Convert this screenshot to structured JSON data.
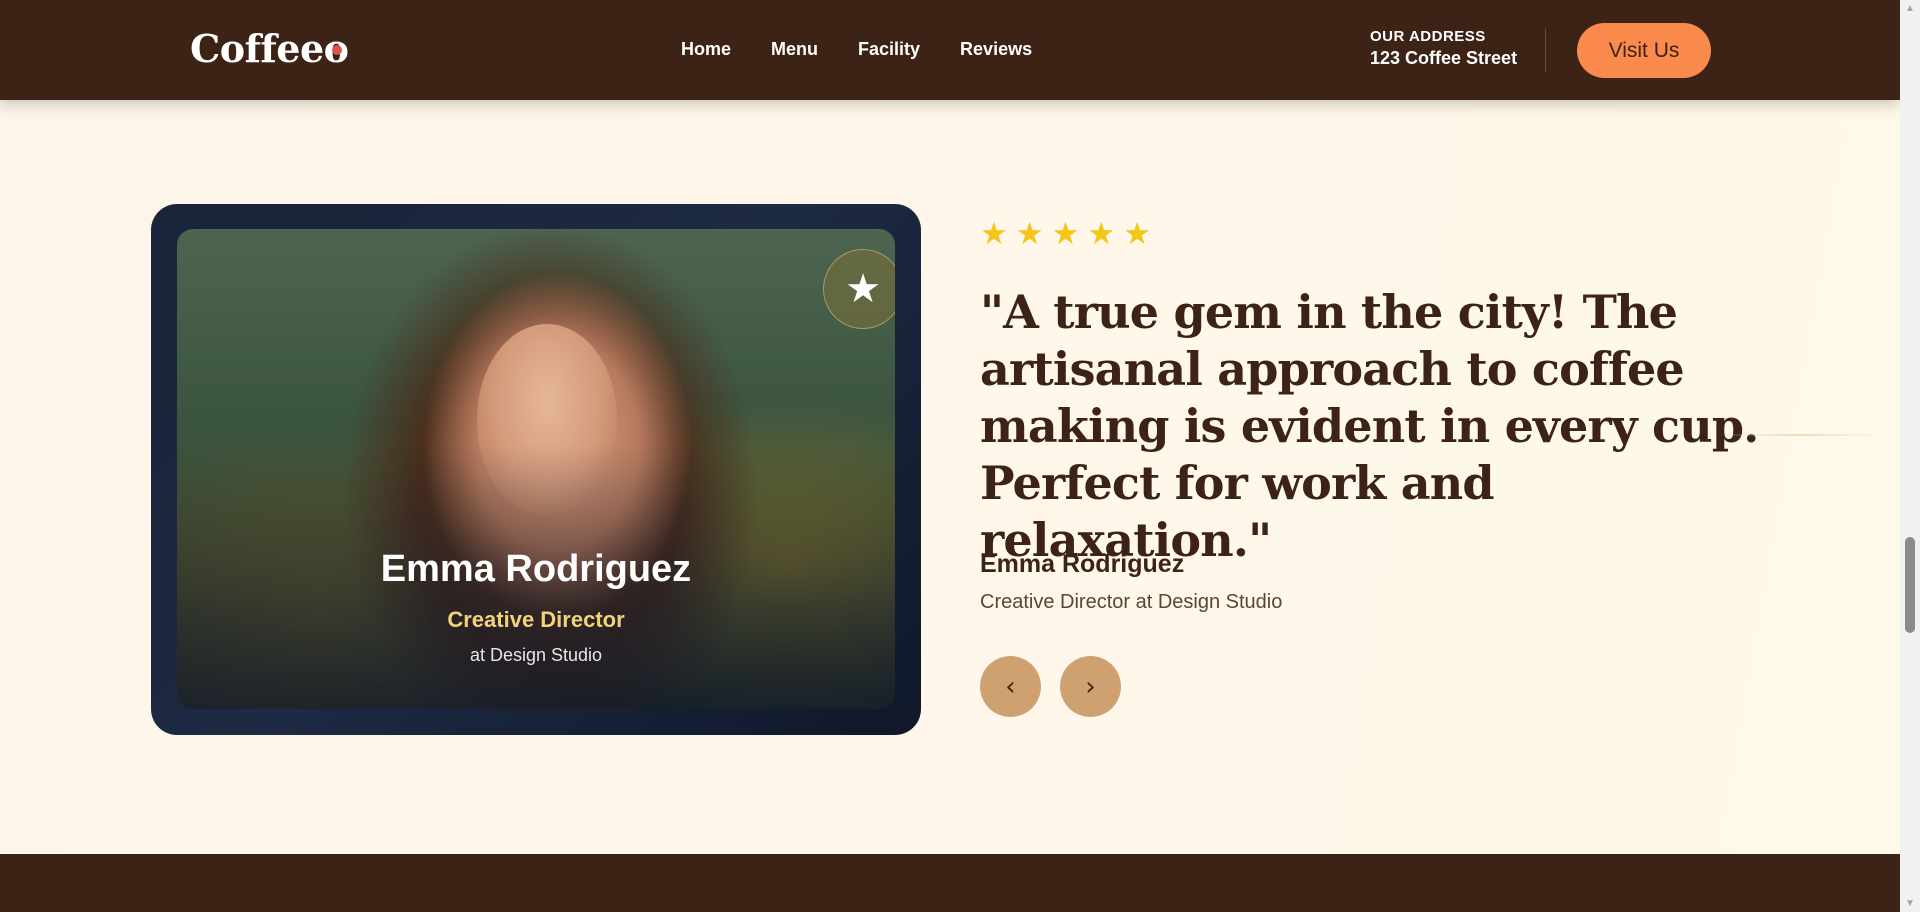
{
  "header": {
    "logo": "Coffeeo",
    "nav": [
      "Home",
      "Menu",
      "Facility",
      "Reviews"
    ],
    "address_label": "OUR ADDRESS",
    "address_value": "123 Coffee Street",
    "cta": "Visit Us"
  },
  "testimonial": {
    "rating": 5,
    "stars": [
      "★",
      "★",
      "★",
      "★",
      "★"
    ],
    "quote": "\"A true gem in the city! The artisanal approach to coffee making is evident in every cup. Perfect for work and relaxation.\"",
    "author": "Emma Rodriguez",
    "author_role": "Creative Director at Design Studio",
    "prev_icon": "‹",
    "next_icon": "›"
  },
  "card": {
    "badge_icon": "★",
    "name": "Emma Rodriguez",
    "role": "Creative Director",
    "company": "at Design Studio"
  },
  "colors": {
    "brand_dark": "#3c2316",
    "accent_orange": "#fb8b4c",
    "star_gold": "#f5c518",
    "nav_button": "#cfa170",
    "card_bg": "#1a243a",
    "role_yellow": "#f2d27a"
  }
}
